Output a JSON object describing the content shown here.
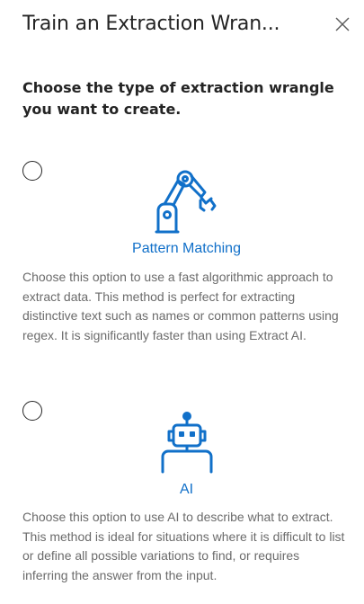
{
  "dialog": {
    "title": "Train an Extraction Wran...",
    "close_icon": "close-icon"
  },
  "prompt": "Choose the type of extraction wrangle you want to create.",
  "options": [
    {
      "label": "Pattern Matching",
      "icon": "robot-arm-icon",
      "selected": false,
      "description": "Choose this option to use a fast algorithmic approach to extract data. This method is perfect for extracting distinctive text such as names or common patterns using regex. It is significantly faster than using Extract AI."
    },
    {
      "label": "AI",
      "icon": "robot-icon",
      "selected": false,
      "description": "Choose this option to use AI to describe what to extract. This method is ideal for situations where it is difficult to list or define all possible variations to find, or requires inferring the answer from the input."
    }
  ],
  "colors": {
    "accent": "#1170c9",
    "text": "#242424",
    "muted": "#6b6b6b"
  }
}
